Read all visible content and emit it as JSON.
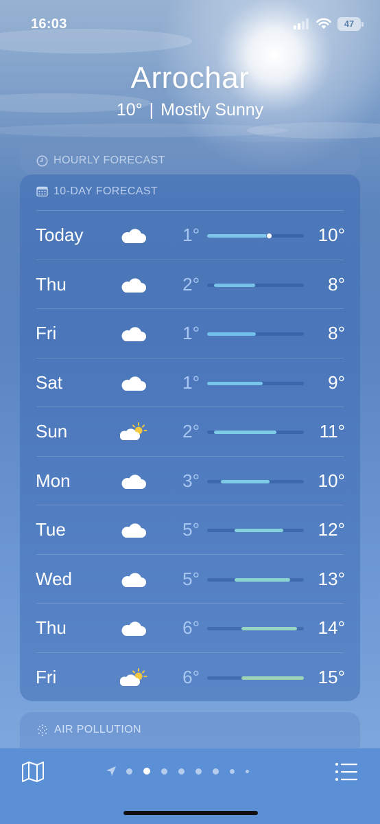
{
  "status_bar": {
    "time": "16:03",
    "battery": "47"
  },
  "location": {
    "city": "Arrochar",
    "current_temp": "10°",
    "condition": "Mostly Sunny"
  },
  "hourly_card": {
    "title": "HOURLY FORECAST",
    "icon": "clock-icon"
  },
  "forecast_card": {
    "title": "10-DAY FORECAST",
    "icon": "calendar-icon",
    "scale_min": 1,
    "scale_max": 15,
    "days": [
      {
        "day": "Today",
        "icon": "cloud-icon",
        "low": "1°",
        "high": "10°",
        "low_value": 1,
        "high_value": 10,
        "current_value": 10,
        "color": "#7ec6ea"
      },
      {
        "day": "Thu",
        "icon": "cloud-icon",
        "low": "2°",
        "high": "8°",
        "low_value": 2,
        "high_value": 8,
        "color": "#78c2ea"
      },
      {
        "day": "Fri",
        "icon": "cloud-icon",
        "low": "1°",
        "high": "8°",
        "low_value": 1,
        "high_value": 8,
        "color": "#74c0ec"
      },
      {
        "day": "Sat",
        "icon": "cloud-icon",
        "low": "1°",
        "high": "9°",
        "low_value": 1,
        "high_value": 9,
        "color": "#78c4ea"
      },
      {
        "day": "Sun",
        "icon": "partly-sunny-icon",
        "low": "2°",
        "high": "11°",
        "low_value": 2,
        "high_value": 11,
        "color": "#7ecbe6"
      },
      {
        "day": "Mon",
        "icon": "cloud-icon",
        "low": "3°",
        "high": "10°",
        "low_value": 3,
        "high_value": 10,
        "color": "#7ecbe6"
      },
      {
        "day": "Tue",
        "icon": "cloud-icon",
        "low": "5°",
        "high": "12°",
        "low_value": 5,
        "high_value": 12,
        "color": "#84d0dc"
      },
      {
        "day": "Wed",
        "icon": "cloud-icon",
        "low": "5°",
        "high": "13°",
        "low_value": 5,
        "high_value": 13,
        "color": "#8cd4d0"
      },
      {
        "day": "Thu",
        "icon": "cloud-icon",
        "low": "6°",
        "high": "14°",
        "low_value": 6,
        "high_value": 14,
        "color": "#96d4c4"
      },
      {
        "day": "Fri",
        "icon": "partly-sunny-icon",
        "low": "6°",
        "high": "15°",
        "low_value": 6,
        "high_value": 15,
        "color": "#a0d4b8"
      }
    ]
  },
  "air_card": {
    "title": "AIR POLLUTION",
    "icon": "dots-icon"
  },
  "bottom_bar": {
    "map_icon": "map-icon",
    "list_icon": "list-icon",
    "page_count": 9,
    "active_page": 2
  }
}
